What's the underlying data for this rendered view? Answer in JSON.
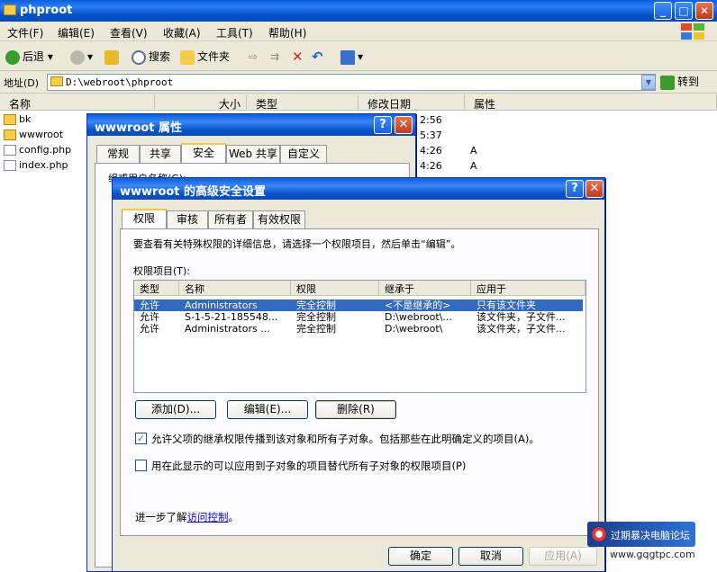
{
  "explorer": {
    "title": "phproot",
    "menu": [
      "文件(F)",
      "编辑(E)",
      "查看(V)",
      "收藏(A)",
      "工具(T)",
      "帮助(H)"
    ],
    "toolbar": {
      "back": "后退",
      "search": "搜索",
      "folders": "文件夹"
    },
    "address_label": "地址(D)",
    "address_value": "D:\\webroot\\phproot",
    "go_label": "转到",
    "columns": [
      "名称",
      "大小",
      "类型",
      "修改日期",
      "属性"
    ],
    "files": [
      "bk",
      "wwwroot",
      "config.php",
      "index.php"
    ],
    "visible_dates": [
      "2:56",
      "5:37",
      "4:26",
      "4:26"
    ],
    "visible_attrs": [
      "A",
      "A"
    ]
  },
  "properties": {
    "title": "wwwroot 属性",
    "tabs": [
      "常规",
      "共享",
      "安全",
      "Web 共享",
      "自定义"
    ],
    "group_label": "组或用户名称(G):"
  },
  "advanced": {
    "title": "wwwroot 的高级安全设置",
    "tabs": [
      "权限",
      "审核",
      "所有者",
      "有效权限"
    ],
    "intro": "要查看有关特殊权限的详细信息，请选择一个权限项目，然后单击“编辑”。",
    "perm_label": "权限项目(T):",
    "list_headers": [
      "类型",
      "名称",
      "权限",
      "继承于",
      "应用于"
    ],
    "rows": [
      {
        "type": "允许",
        "name": "Administrators",
        "perm": "完全控制",
        "from": "<不是继承的>",
        "apply": "只有该文件夹"
      },
      {
        "type": "允许",
        "name": "S-1-5-21-185548...",
        "perm": "完全控制",
        "from": "D:\\webroot\\...",
        "apply": "该文件夹，子文件..."
      },
      {
        "type": "允许",
        "name": "Administrators ...",
        "perm": "完全控制",
        "from": "D:\\webroot\\",
        "apply": "该文件夹，子文件..."
      }
    ],
    "add_label": "添加(D)...",
    "edit_label": "编辑(E)...",
    "remove_label": "删除(R)",
    "inherit_checkbox": "允许父项的继承权限传播到该对象和所有子对象。包括那些在此明确定义的项目(A)。",
    "replace_checkbox": "用在此显示的可以应用到子对象的项目替代所有子对象的权限项目(P)",
    "learn_prefix": "进一步了解",
    "learn_link": "访问控制",
    "learn_suffix": "。",
    "ok_label": "确定",
    "cancel_label": "取消",
    "apply_label": "应用(A)"
  },
  "watermark": {
    "text": "过期暴决电脑论坛",
    "url": "www.gqgtpc.com"
  },
  "colors": {
    "title_blue": "#0a5fdc",
    "selection": "#316ac5",
    "window_bg": "#ece9d8"
  }
}
